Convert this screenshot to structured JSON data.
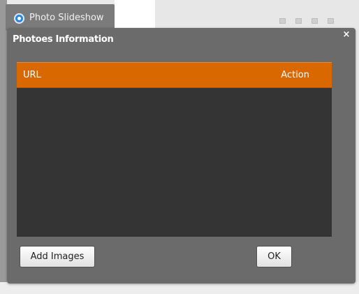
{
  "background_app": {
    "tab_label": "Photo Slideshow",
    "tab_icon": "radio-icon"
  },
  "dialog": {
    "title": "Photoes Information",
    "close_glyph": "×",
    "table": {
      "columns": [
        "URL",
        "Action"
      ],
      "rows": []
    },
    "buttons": {
      "add_images": "Add Images",
      "ok": "OK"
    }
  },
  "colors": {
    "header_accent": "#d96800",
    "dialog_bg": "#6b6b6b",
    "table_bg": "#343434"
  }
}
